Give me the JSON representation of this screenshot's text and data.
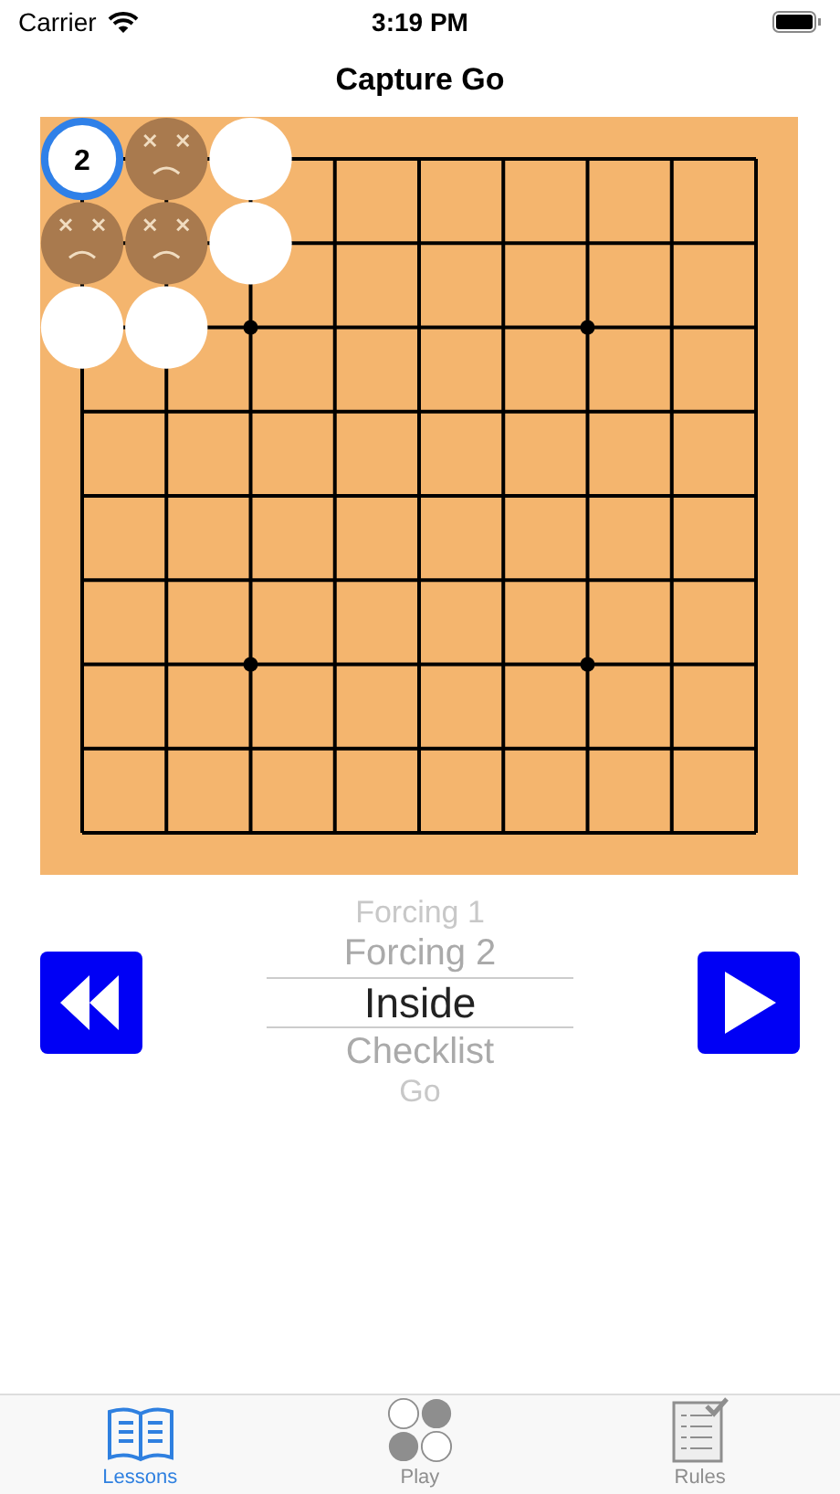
{
  "status_bar": {
    "carrier": "Carrier",
    "time": "3:19 PM"
  },
  "nav": {
    "title": "Capture Go"
  },
  "board": {
    "rows": [
      [
        {
          "kind": "stone",
          "label": "2",
          "last": true
        },
        {
          "kind": "captured",
          "last": false
        },
        {
          "kind": "stone",
          "last": false
        },
        {
          "kind": "empty"
        },
        {
          "kind": "empty"
        },
        {
          "kind": "empty"
        },
        {
          "kind": "empty"
        },
        {
          "kind": "empty"
        },
        {
          "kind": "empty"
        }
      ],
      [
        {
          "kind": "captured",
          "last": false
        },
        {
          "kind": "captured",
          "last": false
        },
        {
          "kind": "stone",
          "last": false
        },
        {
          "kind": "empty"
        },
        {
          "kind": "empty"
        },
        {
          "kind": "empty"
        },
        {
          "kind": "empty"
        },
        {
          "kind": "empty"
        },
        {
          "kind": "empty"
        }
      ],
      [
        {
          "kind": "stone",
          "last": false
        },
        {
          "kind": "stone",
          "last": false
        },
        {
          "kind": "star"
        },
        {
          "kind": "empty"
        },
        {
          "kind": "empty"
        },
        {
          "kind": "empty"
        },
        {
          "kind": "star"
        },
        {
          "kind": "empty"
        },
        {
          "kind": "empty"
        }
      ],
      [
        {
          "kind": "empty"
        },
        {
          "kind": "empty"
        },
        {
          "kind": "empty"
        },
        {
          "kind": "empty"
        },
        {
          "kind": "empty"
        },
        {
          "kind": "empty"
        },
        {
          "kind": "empty"
        },
        {
          "kind": "empty"
        },
        {
          "kind": "empty"
        }
      ],
      [
        {
          "kind": "empty"
        },
        {
          "kind": "empty"
        },
        {
          "kind": "empty"
        },
        {
          "kind": "empty"
        },
        {
          "kind": "empty"
        },
        {
          "kind": "empty"
        },
        {
          "kind": "empty"
        },
        {
          "kind": "empty"
        },
        {
          "kind": "empty"
        }
      ],
      [
        {
          "kind": "empty"
        },
        {
          "kind": "empty"
        },
        {
          "kind": "empty"
        },
        {
          "kind": "empty"
        },
        {
          "kind": "empty"
        },
        {
          "kind": "empty"
        },
        {
          "kind": "empty"
        },
        {
          "kind": "empty"
        },
        {
          "kind": "empty"
        }
      ],
      [
        {
          "kind": "empty"
        },
        {
          "kind": "empty"
        },
        {
          "kind": "star"
        },
        {
          "kind": "empty"
        },
        {
          "kind": "empty"
        },
        {
          "kind": "empty"
        },
        {
          "kind": "star"
        },
        {
          "kind": "empty"
        },
        {
          "kind": "empty"
        }
      ],
      [
        {
          "kind": "empty"
        },
        {
          "kind": "empty"
        },
        {
          "kind": "empty"
        },
        {
          "kind": "empty"
        },
        {
          "kind": "empty"
        },
        {
          "kind": "empty"
        },
        {
          "kind": "empty"
        },
        {
          "kind": "empty"
        },
        {
          "kind": "empty"
        }
      ],
      [
        {
          "kind": "empty"
        },
        {
          "kind": "empty"
        },
        {
          "kind": "empty"
        },
        {
          "kind": "empty"
        },
        {
          "kind": "empty"
        },
        {
          "kind": "empty"
        },
        {
          "kind": "empty"
        },
        {
          "kind": "empty"
        },
        {
          "kind": "empty"
        }
      ]
    ]
  },
  "picker": {
    "items": [
      {
        "label": "Forcing 1",
        "selected": false
      },
      {
        "label": "Forcing 2",
        "selected": false
      },
      {
        "label": "Inside",
        "selected": true
      },
      {
        "label": "Checklist",
        "selected": false
      },
      {
        "label": "Go",
        "selected": false
      }
    ]
  },
  "tabs": [
    {
      "label": "Lessons",
      "kind": "book",
      "selected": true
    },
    {
      "label": "Play",
      "kind": "stones",
      "selected": false
    },
    {
      "label": "Rules",
      "kind": "checklist",
      "selected": false
    }
  ]
}
